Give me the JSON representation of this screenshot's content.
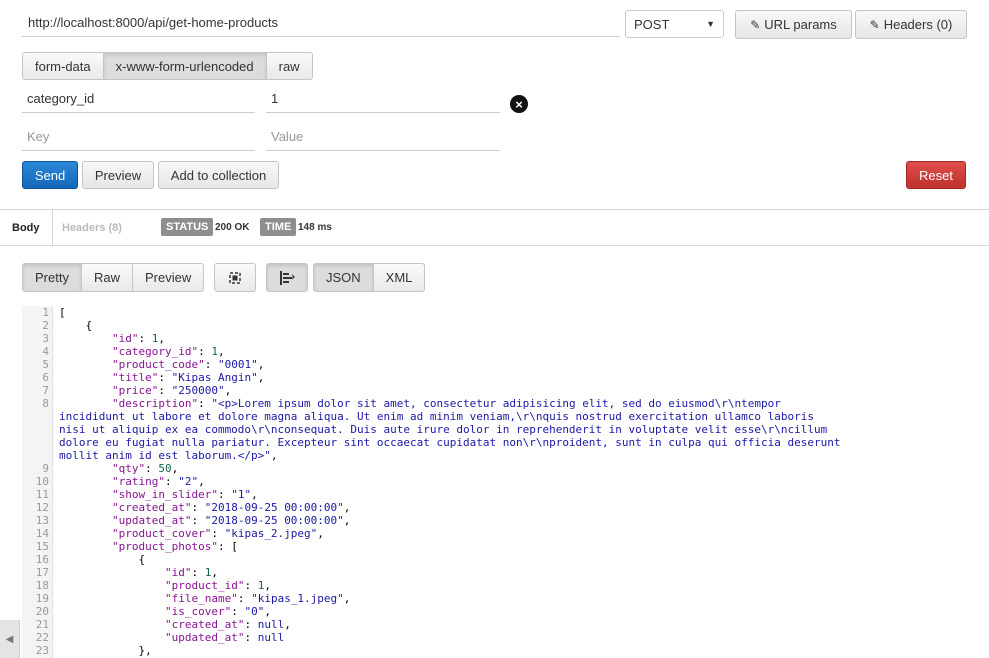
{
  "request": {
    "url": "http://localhost:8000/api/get-home-products",
    "method": "POST",
    "url_params_label": "URL params",
    "headers_label": "Headers (0)"
  },
  "body_modes": [
    "form-data",
    "x-www-form-urlencoded",
    "raw"
  ],
  "active_body_mode": "x-www-form-urlencoded",
  "params": {
    "row1_key": "category_id",
    "row1_value": "1",
    "key_placeholder": "Key",
    "value_placeholder": "Value"
  },
  "actions": {
    "send": "Send",
    "preview": "Preview",
    "add_to_collection": "Add to collection",
    "reset": "Reset"
  },
  "response": {
    "tab_body": "Body",
    "tab_headers": "Headers (8)",
    "status_label": "STATUS",
    "status_value": "200 OK",
    "time_label": "TIME",
    "time_value": "148 ms",
    "view_modes": [
      "Pretty",
      "Raw",
      "Preview"
    ],
    "active_view": "Pretty",
    "formats": [
      "JSON",
      "XML"
    ],
    "active_format": "JSON"
  },
  "colors": {
    "send": "#1a74c8",
    "reset": "#d43f3a",
    "json_key": "#881391",
    "json_string": "#1a1aa6",
    "json_number": "#116644"
  },
  "code_lines": [
    {
      "n": "1",
      "parts": [
        [
          "p",
          "["
        ]
      ]
    },
    {
      "n": "2",
      "parts": [
        [
          "p",
          "    {"
        ]
      ]
    },
    {
      "n": "3",
      "parts": [
        [
          "p",
          "        "
        ],
        [
          "k",
          "\"id\""
        ],
        [
          "p",
          ": "
        ],
        [
          "num",
          "1"
        ],
        [
          "p",
          ","
        ]
      ]
    },
    {
      "n": "4",
      "parts": [
        [
          "p",
          "        "
        ],
        [
          "k",
          "\"category_id\""
        ],
        [
          "p",
          ": "
        ],
        [
          "num",
          "1"
        ],
        [
          "p",
          ","
        ]
      ]
    },
    {
      "n": "5",
      "parts": [
        [
          "p",
          "        "
        ],
        [
          "k",
          "\"product_code\""
        ],
        [
          "p",
          ": "
        ],
        [
          "str",
          "\"0001\""
        ],
        [
          "p",
          ","
        ]
      ]
    },
    {
      "n": "6",
      "parts": [
        [
          "p",
          "        "
        ],
        [
          "k",
          "\"title\""
        ],
        [
          "p",
          ": "
        ],
        [
          "str",
          "\"Kipas Angin\""
        ],
        [
          "p",
          ","
        ]
      ]
    },
    {
      "n": "7",
      "parts": [
        [
          "p",
          "        "
        ],
        [
          "k",
          "\"price\""
        ],
        [
          "p",
          ": "
        ],
        [
          "str",
          "\"250000\""
        ],
        [
          "p",
          ","
        ]
      ]
    },
    {
      "n": "8",
      "parts": [
        [
          "p",
          "        "
        ],
        [
          "k",
          "\"description\""
        ],
        [
          "p",
          ": "
        ],
        [
          "str",
          "\"<p>Lorem ipsum dolor sit amet, consectetur adipisicing elit, sed do eiusmod\\r\\ntempor"
        ]
      ]
    },
    {
      "n": "",
      "parts": [
        [
          "str",
          "incididunt ut labore et dolore magna aliqua. Ut enim ad minim veniam,\\r\\nquis nostrud exercitation ullamco laboris"
        ]
      ]
    },
    {
      "n": "",
      "parts": [
        [
          "str",
          "nisi ut aliquip ex ea commodo\\r\\nconsequat. Duis aute irure dolor in reprehenderit in voluptate velit esse\\r\\ncillum"
        ]
      ]
    },
    {
      "n": "",
      "parts": [
        [
          "str",
          "dolore eu fugiat nulla pariatur. Excepteur sint occaecat cupidatat non\\r\\nproident, sunt in culpa qui officia deserunt"
        ]
      ]
    },
    {
      "n": "",
      "parts": [
        [
          "str",
          "mollit anim id est laborum.</p>\""
        ],
        [
          "p",
          ","
        ]
      ]
    },
    {
      "n": "9",
      "parts": [
        [
          "p",
          "        "
        ],
        [
          "k",
          "\"qty\""
        ],
        [
          "p",
          ": "
        ],
        [
          "num",
          "50"
        ],
        [
          "p",
          ","
        ]
      ]
    },
    {
      "n": "10",
      "parts": [
        [
          "p",
          "        "
        ],
        [
          "k",
          "\"rating\""
        ],
        [
          "p",
          ": "
        ],
        [
          "str",
          "\"2\""
        ],
        [
          "p",
          ","
        ]
      ]
    },
    {
      "n": "11",
      "parts": [
        [
          "p",
          "        "
        ],
        [
          "k",
          "\"show_in_slider\""
        ],
        [
          "p",
          ": "
        ],
        [
          "str",
          "\"1\""
        ],
        [
          "p",
          ","
        ]
      ]
    },
    {
      "n": "12",
      "parts": [
        [
          "p",
          "        "
        ],
        [
          "k",
          "\"created_at\""
        ],
        [
          "p",
          ": "
        ],
        [
          "str",
          "\"2018-09-25 00:00:00\""
        ],
        [
          "p",
          ","
        ]
      ]
    },
    {
      "n": "13",
      "parts": [
        [
          "p",
          "        "
        ],
        [
          "k",
          "\"updated_at\""
        ],
        [
          "p",
          ": "
        ],
        [
          "str",
          "\"2018-09-25 00:00:00\""
        ],
        [
          "p",
          ","
        ]
      ]
    },
    {
      "n": "14",
      "parts": [
        [
          "p",
          "        "
        ],
        [
          "k",
          "\"product_cover\""
        ],
        [
          "p",
          ": "
        ],
        [
          "str",
          "\"kipas_2.jpeg\""
        ],
        [
          "p",
          ","
        ]
      ]
    },
    {
      "n": "15",
      "parts": [
        [
          "p",
          "        "
        ],
        [
          "k",
          "\"product_photos\""
        ],
        [
          "p",
          ": ["
        ]
      ]
    },
    {
      "n": "16",
      "parts": [
        [
          "p",
          "            {"
        ]
      ]
    },
    {
      "n": "17",
      "parts": [
        [
          "p",
          "                "
        ],
        [
          "k",
          "\"id\""
        ],
        [
          "p",
          ": "
        ],
        [
          "num",
          "1"
        ],
        [
          "p",
          ","
        ]
      ]
    },
    {
      "n": "18",
      "parts": [
        [
          "p",
          "                "
        ],
        [
          "k",
          "\"product_id\""
        ],
        [
          "p",
          ": "
        ],
        [
          "num",
          "1"
        ],
        [
          "p",
          ","
        ]
      ]
    },
    {
      "n": "19",
      "parts": [
        [
          "p",
          "                "
        ],
        [
          "k",
          "\"file_name\""
        ],
        [
          "p",
          ": "
        ],
        [
          "str",
          "\"kipas_1.jpeg\""
        ],
        [
          "p",
          ","
        ]
      ]
    },
    {
      "n": "20",
      "parts": [
        [
          "p",
          "                "
        ],
        [
          "k",
          "\"is_cover\""
        ],
        [
          "p",
          ": "
        ],
        [
          "str",
          "\"0\""
        ],
        [
          "p",
          ","
        ]
      ]
    },
    {
      "n": "21",
      "parts": [
        [
          "p",
          "                "
        ],
        [
          "k",
          "\"created_at\""
        ],
        [
          "p",
          ": "
        ],
        [
          "nul",
          "null"
        ],
        [
          "p",
          ","
        ]
      ]
    },
    {
      "n": "22",
      "parts": [
        [
          "p",
          "                "
        ],
        [
          "k",
          "\"updated_at\""
        ],
        [
          "p",
          ": "
        ],
        [
          "nul",
          "null"
        ]
      ]
    },
    {
      "n": "23",
      "parts": [
        [
          "p",
          "            },"
        ]
      ]
    }
  ]
}
